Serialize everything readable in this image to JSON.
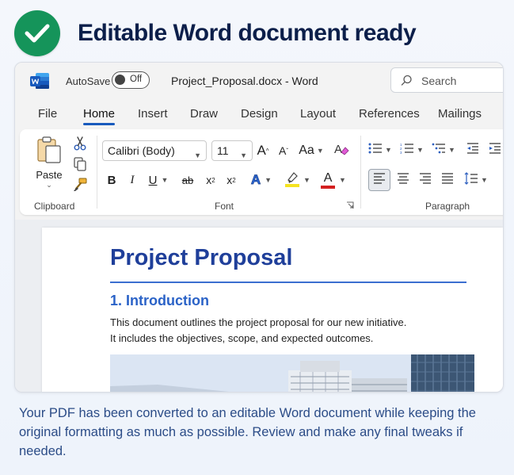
{
  "header": {
    "title": "Editable Word document ready"
  },
  "window": {
    "autosave_label": "AutoSave",
    "autosave_state": "Off",
    "doc_title": "Project_Proposal.docx  -  Word",
    "search_placeholder": "Search"
  },
  "tabs": [
    "File",
    "Home",
    "Insert",
    "Draw",
    "Design",
    "Layout",
    "References",
    "Mailings"
  ],
  "ribbon": {
    "clipboard_label": "Clipboard",
    "paste_label": "Paste",
    "font_label": "Font",
    "paragraph_label": "Paragraph",
    "font_name": "Calibri (Body)",
    "font_size": "11",
    "grow_font": "A",
    "shrink_font": "A",
    "change_case": "Aa",
    "bold": "B",
    "italic": "I",
    "underline": "U",
    "strikethrough": "ab",
    "subscript": "x",
    "superscript": "x",
    "subscript_mark": "2",
    "superscript_mark": "2",
    "text_effects": "A",
    "font_color_letter": "A"
  },
  "colors": {
    "accent": "#185abd",
    "success": "#15945a",
    "heading": "#1f3f9a",
    "highlight": "#f5e320",
    "font_color": "#d42020"
  },
  "document": {
    "heading": "Project Proposal",
    "subheading": "1. Introduction",
    "paragraph_line1": "This document outlines the project proposal for our new initiative.",
    "paragraph_line2": "It includes the objectives, scope, and expected outcomes."
  },
  "footer": {
    "message": "Your PDF has been converted to an editable Word document while keeping the original formatting as much as possible. Review and make any final tweaks if needed."
  }
}
